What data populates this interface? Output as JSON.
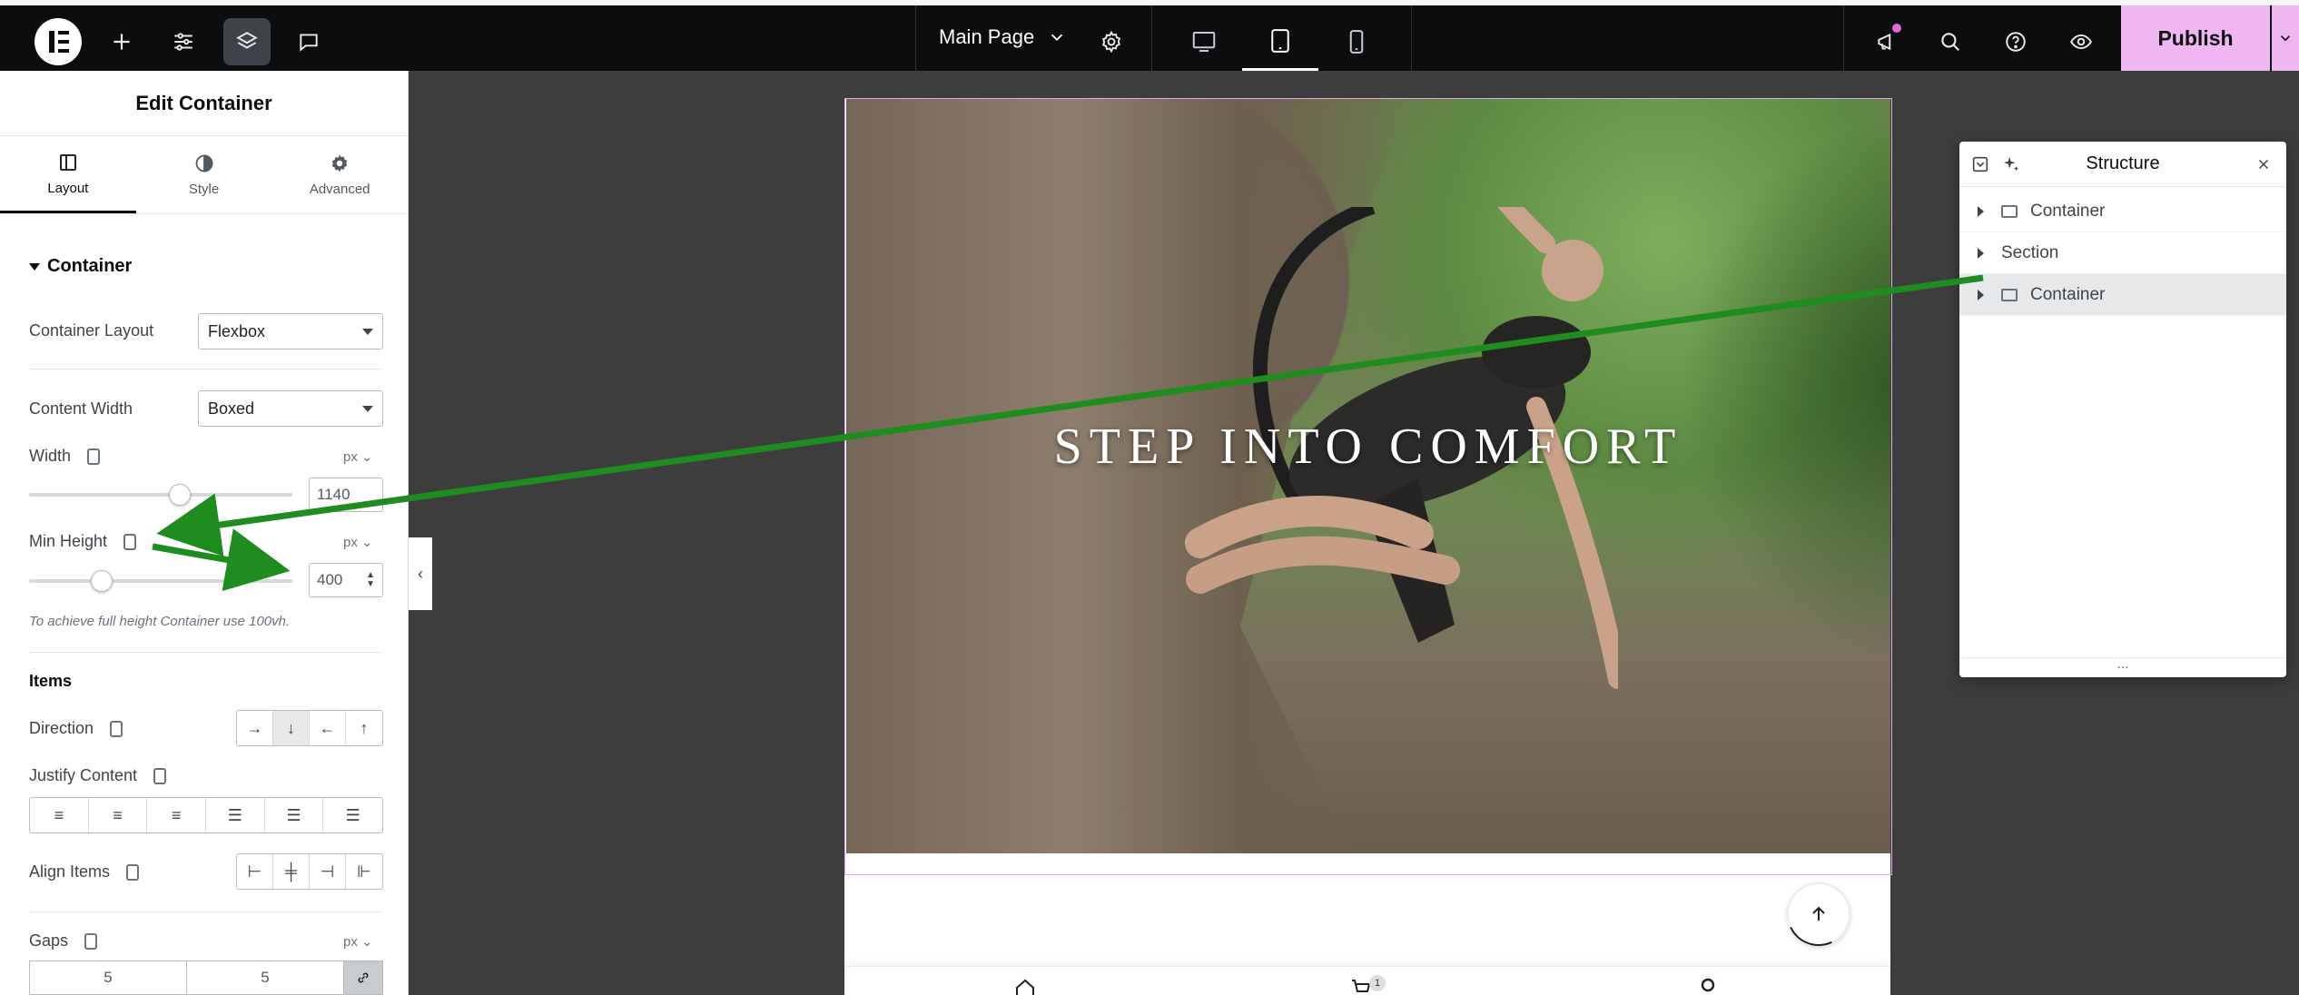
{
  "topbar": {
    "page_name": "Main Page",
    "publish_label": "Publish"
  },
  "panel": {
    "title": "Edit Container",
    "tabs": [
      {
        "label": "Layout"
      },
      {
        "label": "Style"
      },
      {
        "label": "Advanced"
      }
    ],
    "section_container": "Container",
    "container_layout_label": "Container Layout",
    "container_layout_value": "Flexbox",
    "content_width_label": "Content Width",
    "content_width_value": "Boxed",
    "width_label": "Width",
    "width_unit": "px",
    "width_value": "1140",
    "min_height_label": "Min Height",
    "min_height_unit": "px",
    "min_height_value": "400",
    "hint": "To achieve full height Container use 100vh.",
    "items_heading": "Items",
    "direction_label": "Direction",
    "justify_label": "Justify Content",
    "align_label": "Align Items",
    "gaps_label": "Gaps",
    "gaps_unit": "px",
    "gap_column": "5",
    "gap_row": "5"
  },
  "canvas": {
    "hero_title": "STEP  INTO  COMFORT",
    "cart_count": "1"
  },
  "structure": {
    "title": "Structure",
    "rows": [
      {
        "label": "Container"
      },
      {
        "label": "Section"
      },
      {
        "label": "Container"
      }
    ],
    "footer": "..."
  },
  "colors": {
    "accent": "#f0b6f1",
    "annotation_arrow": "#1e8c1e"
  }
}
